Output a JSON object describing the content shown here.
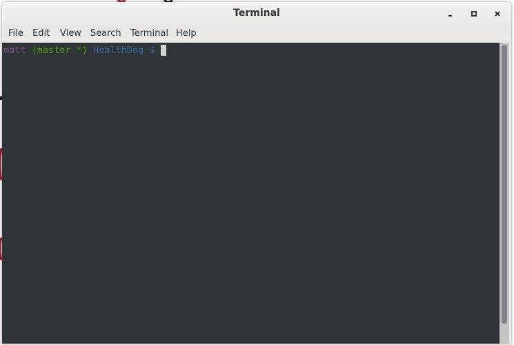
{
  "window": {
    "title": "Terminal",
    "controls": {
      "minimize": "minimize-icon",
      "maximize": "maximize-icon",
      "close": "close-icon"
    }
  },
  "menubar": {
    "items": [
      "File",
      "Edit",
      "View",
      "Search",
      "Terminal",
      "Help"
    ]
  },
  "terminal": {
    "prompt": {
      "user": "matt",
      "branch": "(master *)",
      "directory": "HealthDog",
      "symbol": "$"
    },
    "colors": {
      "background": "#2f3437",
      "user": "#75507b",
      "branch": "#4e9a06",
      "directory": "#3465a4",
      "cursor": "#d3d7cf"
    }
  }
}
